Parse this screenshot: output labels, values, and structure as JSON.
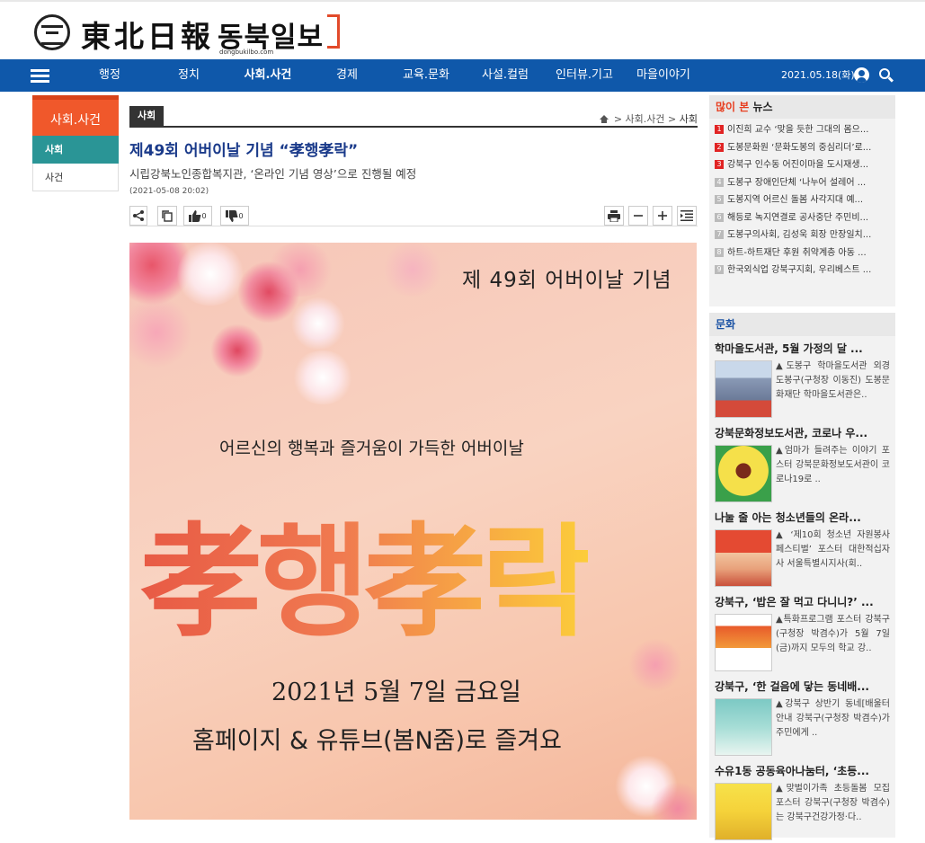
{
  "header": {
    "logo_hanja": "東北日報",
    "logo_korean": "동북일보",
    "logo_url": "dongbukilbo.com"
  },
  "nav": {
    "items": [
      "행정",
      "정치",
      "사회.사건",
      "경제",
      "교육.문화",
      "사설.컬럼",
      "인터뷰.기고",
      "마을이야기"
    ],
    "active": "사회.사건",
    "date": "2021.05.18(화)"
  },
  "side_nav": {
    "heading": "사회.사건",
    "items": [
      "사회",
      "사건"
    ]
  },
  "article": {
    "section": "사회",
    "breadcrumb": [
      ">",
      "사회.사건",
      ">",
      "사회"
    ],
    "title": "제49회 어버이날 기념 “孝행孝락”",
    "subtitle": "시립강북노인종합복지관, ‘온라인 기념 영상’으로 진행될 예정",
    "date": "(2021-05-08 20:02)",
    "like_count": "0",
    "dislike_count": "0",
    "image": {
      "line1": "제 49회 어버이날 기념",
      "line2": "어르신의 행복과 즐거움이 가득한 어버이날",
      "big": "孝행孝락",
      "date": "2021년 5월 7일 금요일",
      "channel": "홈페이지 & 유튜브(봄N줌)로 즐겨요"
    }
  },
  "popular": {
    "title_red": "많이 본",
    "title_dark": " 뉴스",
    "items": [
      {
        "rank": "1",
        "text": "이진희 교수 ‘맞을 듯한 그대의 몸으..."
      },
      {
        "rank": "2",
        "text": "도봉문화원 ‘문화도봉의 중심리더’로..."
      },
      {
        "rank": "3",
        "text": "강북구 인수동 어진이마을 도시재생..."
      },
      {
        "rank": "4",
        "text": "도봉구 장애인단체 ‘나누어 설레어 ..."
      },
      {
        "rank": "5",
        "text": "도봉지역 어르신 돌봄 사각지대 예..."
      },
      {
        "rank": "6",
        "text": "해등로 녹지연결로 공사중단 주민비..."
      },
      {
        "rank": "7",
        "text": "도봉구의사회, 김성욱 회장 만장일치..."
      },
      {
        "rank": "8",
        "text": "하트-하트재단 후원 취약계층 아동 ..."
      },
      {
        "rank": "9",
        "text": "한국외식업 강북구지회, 우리베스트 ..."
      }
    ]
  },
  "culture": {
    "title": "문화",
    "items": [
      {
        "title": "학마을도서관, 5월 가정의 달 ...",
        "text": "▲도봉구 학마을도서관 외경 도봉구(구청장 이동진) 도봉문화재단 학마을도서관은.."
      },
      {
        "title": "강북문화정보도서관, 코로나 우...",
        "text": "▲엄마가 들려주는 이야기 포스터 강북문화정보도서관이 코로나19로 .."
      },
      {
        "title": "나눌 줄 아는 청소년들의 온라...",
        "text": "▲ ‘제10회 청소년 자원봉사 페스티벌’ 포스터 대한적십자사 서울특별시지사(회.."
      },
      {
        "title": "강북구, ‘밥은 잘 먹고 다니니?’ ...",
        "text": "▲특화프로그램 포스터 강북구(구청장 박겸수)가 5월 7일(금)까지 모두의 학교 강.."
      },
      {
        "title": "강북구, ‘한 걸음에 닿는 동네배...",
        "text": "▲강북구 상반기 동네[배울터 안내 강북구(구청장 박겸수)가 주민에게 .."
      },
      {
        "title": "수유1동 공동육아나눔터, ‘초등...",
        "text": "▲맞벌이가족 초등돌봄 모집 포스터 강북구(구청장 박겸수)는 강북구건강가정·다.."
      }
    ]
  },
  "colors": {
    "nav_bg": "#0f58aa",
    "accent_orange": "#f0582b",
    "accent_teal": "#2a9596",
    "title_blue": "#1a3a8a",
    "rank_red": "#e12424"
  }
}
